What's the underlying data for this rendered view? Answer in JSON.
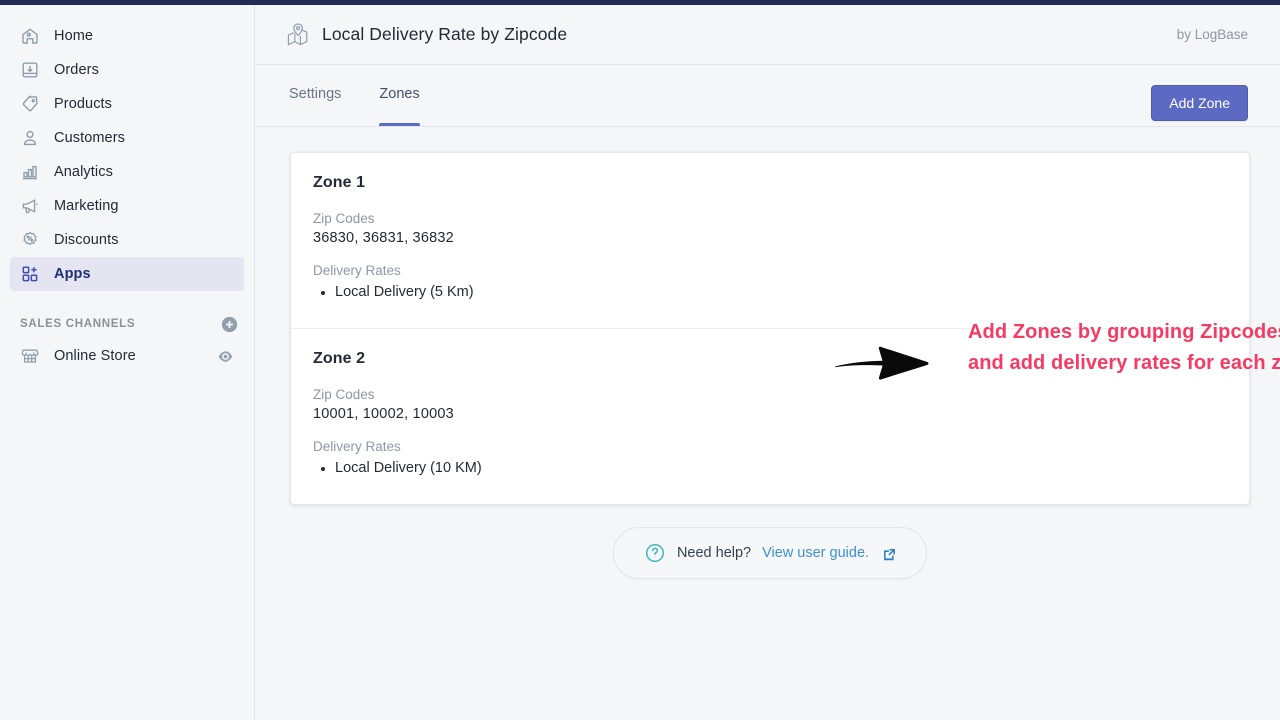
{
  "theme": {
    "topbar_color": "#212b58",
    "accent_color": "#5c6ac4",
    "annotation_color": "#f73a63",
    "link_color": "#3e8fd6",
    "help_icon_color": "#3ab7bf",
    "page_background": "#f4f6f8"
  },
  "sidebar": {
    "items": [
      {
        "label": "Home",
        "icon": "home-icon",
        "active": false
      },
      {
        "label": "Orders",
        "icon": "orders-inbox-icon",
        "active": false
      },
      {
        "label": "Products",
        "icon": "tag-icon",
        "active": false
      },
      {
        "label": "Customers",
        "icon": "person-icon",
        "active": false
      },
      {
        "label": "Analytics",
        "icon": "bar-chart-icon",
        "active": false
      },
      {
        "label": "Marketing",
        "icon": "megaphone-icon",
        "active": false
      },
      {
        "label": "Discounts",
        "icon": "discount-badge-icon",
        "active": false
      },
      {
        "label": "Apps",
        "icon": "apps-plus-icon",
        "active": true
      }
    ],
    "section": {
      "title": "SALES CHANNELS",
      "add_icon": "plus-circle-icon",
      "channels": [
        {
          "label": "Online Store",
          "icon": "storefront-icon",
          "trailing_icon": "eye-icon"
        }
      ]
    }
  },
  "header": {
    "app_icon": "map-pin-icon",
    "title": "Local Delivery Rate by Zipcode",
    "byline": "by LogBase"
  },
  "tabbar": {
    "tabs": [
      {
        "label": "Settings",
        "active": false
      },
      {
        "label": "Zones",
        "active": true
      }
    ],
    "add_zone_label": "Add Zone"
  },
  "zones": {
    "zip_codes_label": "Zip Codes",
    "delivery_rates_label": "Delivery Rates",
    "items": [
      {
        "title": "Zone 1",
        "zip_codes": "36830, 36831, 36832",
        "rates": [
          "Local Delivery (5 Km)"
        ]
      },
      {
        "title": "Zone 2",
        "zip_codes": "10001, 10002, 10003",
        "rates": [
          "Local Delivery (10 KM)"
        ]
      }
    ]
  },
  "annotation": {
    "arrow_icon": "right-arrow-annotation",
    "text": "Add Zones by grouping Zipcodes and add delivery rates for each zone"
  },
  "help": {
    "icon": "question-circle-icon",
    "text": "Need help?",
    "link_label": "View user guide.",
    "external_icon": "external-link-icon"
  }
}
